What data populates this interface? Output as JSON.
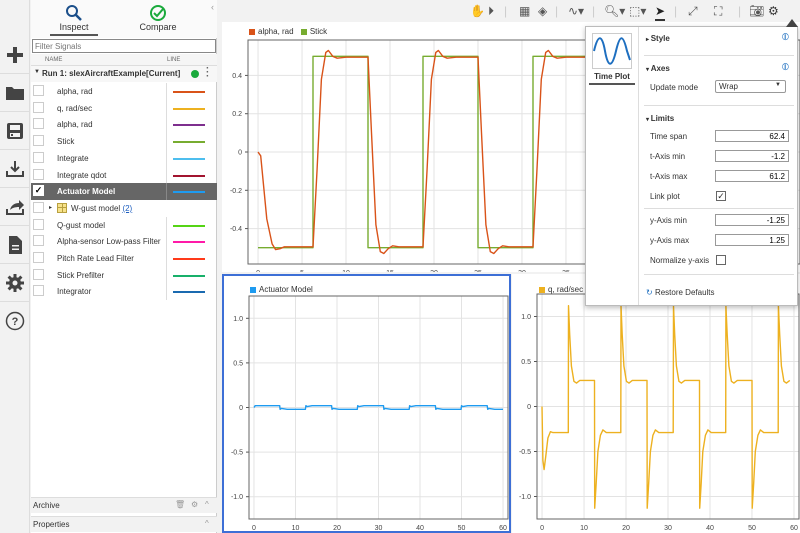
{
  "leftbar": {
    "icons": [
      "add-icon",
      "folder-icon",
      "save-icon",
      "download-icon",
      "share-icon",
      "document-icon",
      "gear-icon",
      "help-icon"
    ]
  },
  "signal_panel": {
    "tabs": [
      {
        "label": "Inspect",
        "active": true
      },
      {
        "label": "Compare",
        "active": false
      }
    ],
    "filter_placeholder": "Filter Signals",
    "columns": {
      "name": "NAME",
      "line": "LINE"
    },
    "run": {
      "label": "Run 1: slexAircraftExample[Current]",
      "status_color": "#1aaa3c"
    },
    "signals": [
      {
        "name": "alpha, rad",
        "color": "#d95319",
        "checked": false
      },
      {
        "name": "q, rad/sec",
        "color": "#edb120",
        "checked": false
      },
      {
        "name": "alpha, rad",
        "color": "#7e2f8e",
        "checked": false
      },
      {
        "name": "Stick",
        "color": "#77ac30",
        "checked": false
      },
      {
        "name": "Integrate",
        "color": "#4dbeee",
        "checked": false
      },
      {
        "name": "Integrate qdot",
        "color": "#a2142f",
        "checked": false
      },
      {
        "name": "Actuator Model",
        "color": "#1e9bf0",
        "checked": true,
        "selected": true
      },
      {
        "name": "W-gust model",
        "group": true,
        "count": "2"
      },
      {
        "name": "Q-gust model",
        "color": "#55d415",
        "checked": false
      },
      {
        "name": "Alpha-sensor Low-pass Filter",
        "color": "#ff1aa8",
        "checked": false
      },
      {
        "name": "Pitch Rate Lead Filter",
        "color": "#ff3a1a",
        "checked": false
      },
      {
        "name": "Stick Prefilter",
        "color": "#18b06a",
        "checked": false
      },
      {
        "name": "Integrator",
        "color": "#1a6ab0",
        "checked": false
      }
    ],
    "archive_label": "Archive",
    "properties_label": "Properties"
  },
  "toolbar": {
    "icons": [
      "pan-icon",
      "play-icon",
      "layout-icon",
      "eraser-icon",
      "signal-icon",
      "zoom-icon",
      "fit-icon",
      "cursor-icon",
      "expand-icon",
      "fullscreen-icon",
      "camera-icon",
      "gear-icon"
    ]
  },
  "properties": {
    "viz_label": "Time Plot",
    "style_label": "Style",
    "axes_label": "Axes",
    "update_mode_label": "Update mode",
    "update_mode_value": "Wrap",
    "limits_label": "Limits",
    "time_span_label": "Time span",
    "time_span_value": "62.4",
    "tmin_label": "t-Axis min",
    "tmin_value": "-1.2",
    "tmax_label": "t-Axis max",
    "tmax_value": "61.2",
    "link_plot_label": "Link plot",
    "link_plot_checked": true,
    "ymin_label": "y-Axis min",
    "ymin_value": "-1.25",
    "ymax_label": "y-Axis max",
    "ymax_value": "1.25",
    "normalize_label": "Normalize y-axis",
    "normalize_checked": false,
    "restore_label": "Restore Defaults"
  },
  "chart_data": [
    {
      "type": "line",
      "title": "",
      "legend": [
        {
          "name": "alpha, rad",
          "color": "#d95319"
        },
        {
          "name": "Stick",
          "color": "#77ac30"
        }
      ],
      "xlim": [
        -1.2,
        38
      ],
      "ylim": [
        -0.58,
        0.58
      ],
      "xticks": [
        0,
        5,
        10,
        15,
        20,
        25,
        30,
        35
      ],
      "yticks": [
        -0.4,
        -0.2,
        0,
        0.2,
        0.4
      ],
      "ytick_labels": [
        "-0.4",
        "-0.2",
        "0",
        "0.2",
        "0.4"
      ],
      "grid": true,
      "series": [
        {
          "name": "Stick",
          "color": "#77ac30",
          "x": [
            0,
            6.25,
            6.25,
            12.5,
            12.5,
            18.75,
            18.75,
            25,
            25,
            31.25,
            31.25,
            37.5,
            37.5,
            38
          ],
          "y": [
            -0.5,
            -0.5,
            0.5,
            0.5,
            -0.5,
            -0.5,
            0.5,
            0.5,
            -0.5,
            -0.5,
            0.5,
            0.5,
            -0.5,
            -0.5
          ]
        },
        {
          "name": "alpha, rad",
          "color": "#d95319",
          "x": [
            0,
            0.3,
            1,
            1.6,
            2,
            2.5,
            3,
            4,
            6.25,
            6.7,
            7.2,
            7.7,
            8,
            8.5,
            9,
            10,
            12.5,
            12.9,
            13.4,
            13.9,
            14.3,
            14.8,
            15.3,
            16,
            18.75,
            19.2,
            19.7,
            20.2,
            20.5,
            21,
            21.5,
            22.5,
            25,
            25.4,
            25.9,
            26.4,
            26.8,
            27.3,
            27.8,
            28.5,
            31.25,
            31.7,
            32.2,
            32.7,
            33,
            33.5,
            34,
            35,
            38
          ],
          "y": [
            0,
            -0.02,
            -0.35,
            -0.48,
            -0.51,
            -0.505,
            -0.495,
            -0.495,
            -0.495,
            -0.1,
            0.38,
            0.52,
            0.53,
            0.5,
            0.49,
            0.495,
            0.495,
            0.1,
            -0.38,
            -0.52,
            -0.53,
            -0.505,
            -0.49,
            -0.495,
            -0.495,
            -0.1,
            0.38,
            0.52,
            0.53,
            0.5,
            0.49,
            0.495,
            0.495,
            0.1,
            -0.38,
            -0.52,
            -0.53,
            -0.505,
            -0.49,
            -0.495,
            -0.495,
            -0.1,
            0.38,
            0.52,
            0.53,
            0.5,
            0.49,
            0.495,
            0.495
          ]
        }
      ]
    },
    {
      "type": "line",
      "legend": [
        {
          "name": "Actuator Model",
          "color": "#1e9bf0"
        }
      ],
      "xlim": [
        -1.2,
        61.2
      ],
      "ylim": [
        -1.25,
        1.25
      ],
      "xticks": [
        0,
        10,
        20,
        30,
        40,
        50,
        60
      ],
      "yticks": [
        -1.0,
        -0.5,
        0,
        0.5,
        1.0
      ],
      "ytick_labels": [
        "-1.0",
        "-0.5",
        "0",
        "0.5",
        "1.0"
      ],
      "grid": true,
      "series": [
        {
          "name": "Actuator Model",
          "color": "#1e9bf0",
          "x": [
            0,
            0.3,
            6.2,
            6.3,
            6.6,
            8,
            12.4,
            12.5,
            12.8,
            14,
            18.7,
            18.8,
            19.1,
            20.5,
            24.9,
            25,
            25.3,
            26.5,
            31.2,
            31.3,
            31.6,
            33,
            37.4,
            37.5,
            37.8,
            39,
            43.7,
            43.8,
            44.1,
            45.5,
            49.9,
            50,
            50.3,
            51.5,
            56.2,
            56.3,
            56.6,
            58,
            60
          ],
          "y": [
            0,
            0.02,
            0.02,
            -0.02,
            -0.01,
            -0.02,
            -0.02,
            0.02,
            0.01,
            0.02,
            0.02,
            -0.02,
            -0.01,
            -0.02,
            -0.02,
            0.02,
            0.01,
            0.02,
            0.02,
            -0.02,
            -0.01,
            -0.02,
            -0.02,
            0.02,
            0.01,
            0.02,
            0.02,
            -0.02,
            -0.01,
            -0.02,
            -0.02,
            0.02,
            0.01,
            0.02,
            0.02,
            -0.02,
            -0.01,
            -0.02,
            -0.02
          ]
        }
      ]
    },
    {
      "type": "line",
      "legend": [
        {
          "name": "q, rad/sec",
          "color": "#edb120"
        }
      ],
      "xlim": [
        -1.2,
        61.2
      ],
      "ylim": [
        -1.25,
        1.25
      ],
      "xticks": [
        0,
        10,
        20,
        30,
        40,
        50,
        60
      ],
      "yticks": [
        -1.0,
        -0.5,
        0,
        0.5,
        1.0
      ],
      "ytick_labels": [
        "-1.0",
        "-0.5",
        "0",
        "0.5",
        "1.0"
      ],
      "grid": true,
      "series": [
        {
          "name": "q, rad/sec",
          "color": "#edb120",
          "x": [
            0,
            0.2,
            0.5,
            0.9,
            1.4,
            2,
            2.6,
            3.5,
            6.25,
            6.3,
            6.6,
            7,
            7.6,
            8.2,
            9,
            9.8,
            12.5,
            12.55,
            12.9,
            13.3,
            13.9,
            14.5,
            15.3,
            16.2,
            18.75,
            18.8,
            19.1,
            19.5,
            20.1,
            20.7,
            21.5,
            22.4,
            25,
            25.05,
            25.4,
            25.8,
            26.4,
            27,
            27.8,
            28.7,
            31.25,
            31.3,
            31.6,
            32,
            32.6,
            33.2,
            34,
            34.9,
            37.5,
            37.55,
            37.9,
            38.3,
            38.9,
            39.5,
            40.3,
            41.2,
            43.75,
            43.8,
            44.1,
            44.5,
            45.1,
            45.7,
            46.5,
            47.4,
            50,
            50.05,
            50.4,
            50.8,
            51.4,
            52,
            52.8,
            53.7,
            56.25,
            56.3,
            56.6,
            57,
            57.6,
            58.2,
            59,
            60
          ],
          "y": [
            0,
            -0.6,
            -0.7,
            -0.55,
            -0.35,
            -0.28,
            -0.29,
            -0.29,
            -0.29,
            1.12,
            0.8,
            0.45,
            0.28,
            0.26,
            0.29,
            0.29,
            0.29,
            -1.13,
            -0.85,
            -0.5,
            -0.32,
            -0.26,
            -0.29,
            -0.29,
            -0.29,
            1.12,
            0.8,
            0.45,
            0.28,
            0.26,
            0.29,
            0.29,
            0.29,
            -1.13,
            -0.85,
            -0.5,
            -0.32,
            -0.26,
            -0.29,
            -0.29,
            -0.29,
            1.12,
            0.8,
            0.45,
            0.28,
            0.26,
            0.29,
            0.29,
            0.29,
            -1.13,
            -0.85,
            -0.5,
            -0.32,
            -0.26,
            -0.29,
            -0.29,
            -0.29,
            1.12,
            0.8,
            0.45,
            0.28,
            0.26,
            0.29,
            0.29,
            0.29,
            -1.13,
            -0.85,
            -0.5,
            -0.32,
            -0.26,
            -0.29,
            -0.29,
            -0.29,
            1.12,
            0.8,
            0.45,
            0.28,
            0.26,
            0.29
          ]
        }
      ]
    }
  ]
}
